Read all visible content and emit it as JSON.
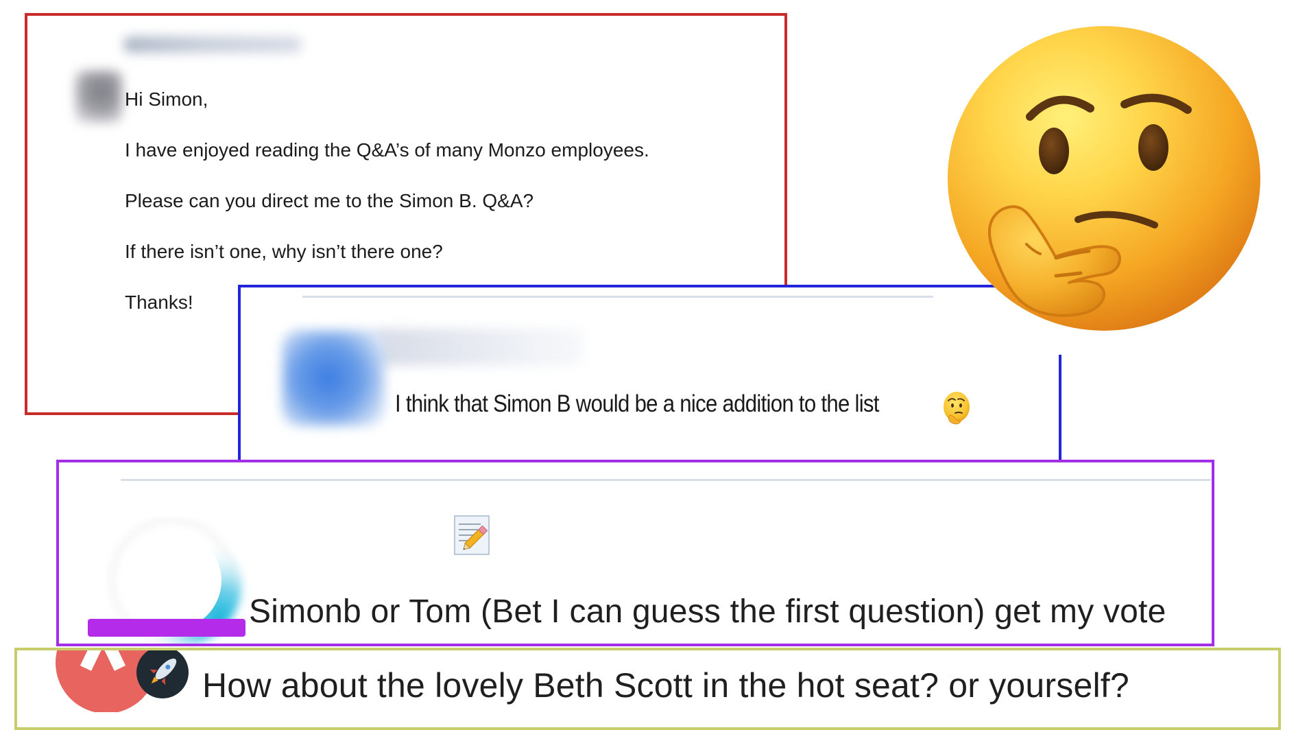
{
  "email": {
    "greeting": "Hi Simon,",
    "line1": "I have enjoyed reading the Q&A’s of many Monzo employees.",
    "line2": "Please can you direct me to the Simon B. Q&A?",
    "line3": "If there isn’t one, why isn’t there one?",
    "signoff": "Thanks!"
  },
  "comment": {
    "text": "I think that Simon B would be a nice addition to the list",
    "emoji_icon": "thinking-face-icon"
  },
  "vote": {
    "icon": "memo-pencil-icon",
    "text": "Simonb or Tom (Bet I can guess the first question) get my vote"
  },
  "question": {
    "badge_icon": "rocket-icon",
    "text": "How about the lovely Beth Scott in the hot seat? or yourself?"
  },
  "decoration": {
    "main_emoji": "thinking-face-icon"
  },
  "colors": {
    "email_border": "#c92b2b",
    "comment_border": "#2323d9",
    "vote_border": "#a22ee8",
    "question_border": "#c6cd6a",
    "redaction": "#b42be9"
  }
}
